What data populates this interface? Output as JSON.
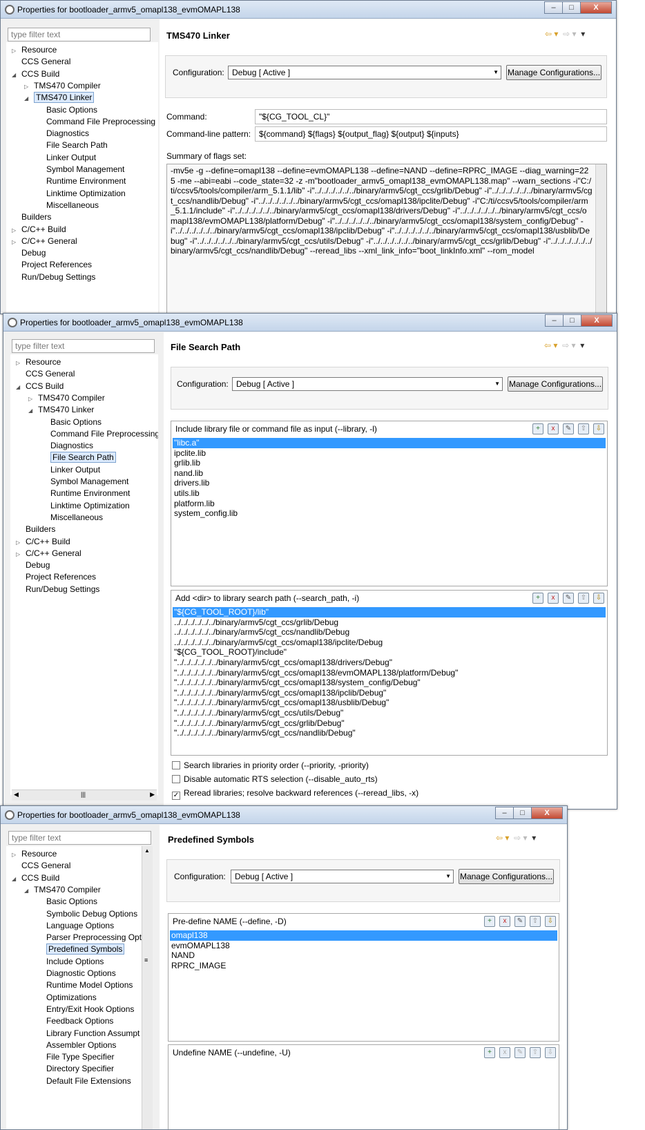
{
  "window_title": "Properties for bootloader_armv5_omapl138_evmOMAPL138",
  "window_buttons": {
    "minimize": "–",
    "maximize": "□",
    "close": "X"
  },
  "filter_placeholder": "type filter text",
  "config": {
    "label": "Configuration:",
    "value": "Debug  [ Active ]",
    "manage": "Manage Configurations..."
  },
  "nav": {
    "back": "⇦ ▾",
    "fwd": "⇨ ▾",
    "menu": "▾"
  },
  "win1": {
    "title": "TMS470 Linker",
    "tree": [
      {
        "label": "Resource",
        "d": 0,
        "arr": "▷"
      },
      {
        "label": "CCS General",
        "d": 0,
        "arr": ""
      },
      {
        "label": "CCS Build",
        "d": 0,
        "arr": "◢"
      },
      {
        "label": "TMS470 Compiler",
        "d": 1,
        "arr": "▷"
      },
      {
        "label": "TMS470 Linker",
        "d": 1,
        "arr": "◢",
        "sel": true
      },
      {
        "label": "Basic Options",
        "d": 2,
        "arr": ""
      },
      {
        "label": "Command File Preprocessing",
        "d": 2,
        "arr": ""
      },
      {
        "label": "Diagnostics",
        "d": 2,
        "arr": ""
      },
      {
        "label": "File Search Path",
        "d": 2,
        "arr": ""
      },
      {
        "label": "Linker Output",
        "d": 2,
        "arr": ""
      },
      {
        "label": "Symbol Management",
        "d": 2,
        "arr": ""
      },
      {
        "label": "Runtime Environment",
        "d": 2,
        "arr": ""
      },
      {
        "label": "Linktime Optimization",
        "d": 2,
        "arr": ""
      },
      {
        "label": "Miscellaneous",
        "d": 2,
        "arr": ""
      },
      {
        "label": "Builders",
        "d": 0,
        "arr": ""
      },
      {
        "label": "C/C++ Build",
        "d": 0,
        "arr": "▷"
      },
      {
        "label": "C/C++ General",
        "d": 0,
        "arr": "▷"
      },
      {
        "label": "Debug",
        "d": 0,
        "arr": ""
      },
      {
        "label": "Project References",
        "d": 0,
        "arr": ""
      },
      {
        "label": "Run/Debug Settings",
        "d": 0,
        "arr": ""
      }
    ],
    "command_label": "Command:",
    "command_value": "\"${CG_TOOL_CL}\"",
    "pattern_label": "Command-line pattern:",
    "pattern_value": "${command} ${flags} ${output_flag} ${output} ${inputs}",
    "summary_label": "Summary of flags set:",
    "summary_text": "-mv5e -g --define=omapl138 --define=evmOMAPL138 --define=NAND --define=RPRC_IMAGE --diag_warning=225 -me --abi=eabi --code_state=32 -z -m\"bootloader_armv5_omapl138_evmOMAPL138.map\" --warn_sections -i\"C:/ti/ccsv5/tools/compiler/arm_5.1.1/lib\" -i\"../../../../../../binary/armv5/cgt_ccs/grlib/Debug\" -i\"../../../../../../binary/armv5/cgt_ccs/nandlib/Debug\" -i\"../../../../../../binary/armv5/cgt_ccs/omapl138/ipclite/Debug\" -i\"C:/ti/ccsv5/tools/compiler/arm_5.1.1/include\" -i\"../../../../../../binary/armv5/cgt_ccs/omapl138/drivers/Debug\" -i\"../../../../../../binary/armv5/cgt_ccs/omapl138/evmOMAPL138/platform/Debug\" -i\"../../../../../../binary/armv5/cgt_ccs/omapl138/system_config/Debug\" -i\"../../../../../../binary/armv5/cgt_ccs/omapl138/ipclib/Debug\" -i\"../../../../../../binary/armv5/cgt_ccs/omapl138/usblib/Debug\" -i\"../../../../../../binary/armv5/cgt_ccs/utils/Debug\" -i\"../../../../../../binary/armv5/cgt_ccs/grlib/Debug\" -i\"../../../../../../binary/armv5/cgt_ccs/nandlib/Debug\" --reread_libs --xml_link_info=\"boot_linkInfo.xml\" --rom_model"
  },
  "win2": {
    "title": "File Search Path",
    "tree": [
      {
        "label": "Resource",
        "d": 0,
        "arr": "▷"
      },
      {
        "label": "CCS General",
        "d": 0,
        "arr": ""
      },
      {
        "label": "CCS Build",
        "d": 0,
        "arr": "◢"
      },
      {
        "label": "TMS470 Compiler",
        "d": 1,
        "arr": "▷"
      },
      {
        "label": "TMS470 Linker",
        "d": 1,
        "arr": "◢"
      },
      {
        "label": "Basic Options",
        "d": 2,
        "arr": ""
      },
      {
        "label": "Command File Preprocessing",
        "d": 2,
        "arr": ""
      },
      {
        "label": "Diagnostics",
        "d": 2,
        "arr": ""
      },
      {
        "label": "File Search Path",
        "d": 2,
        "arr": "",
        "sel": true
      },
      {
        "label": "Linker Output",
        "d": 2,
        "arr": ""
      },
      {
        "label": "Symbol Management",
        "d": 2,
        "arr": ""
      },
      {
        "label": "Runtime Environment",
        "d": 2,
        "arr": ""
      },
      {
        "label": "Linktime Optimization",
        "d": 2,
        "arr": ""
      },
      {
        "label": "Miscellaneous",
        "d": 2,
        "arr": ""
      },
      {
        "label": "Builders",
        "d": 0,
        "arr": ""
      },
      {
        "label": "C/C++ Build",
        "d": 0,
        "arr": "▷"
      },
      {
        "label": "C/C++ General",
        "d": 0,
        "arr": "▷"
      },
      {
        "label": "Debug",
        "d": 0,
        "arr": ""
      },
      {
        "label": "Project References",
        "d": 0,
        "arr": ""
      },
      {
        "label": "Run/Debug Settings",
        "d": 0,
        "arr": ""
      }
    ],
    "lib_header": "Include library file or command file as input (--library, -l)",
    "lib_items": [
      "\"libc.a\"",
      "ipclite.lib",
      "grlib.lib",
      "nand.lib",
      "drivers.lib",
      "utils.lib",
      "platform.lib",
      "system_config.lib"
    ],
    "path_header": "Add <dir> to library search path (--search_path, -i)",
    "path_items": [
      "\"${CG_TOOL_ROOT}/lib\"",
      "../../../../../../binary/armv5/cgt_ccs/grlib/Debug",
      "../../../../../../binary/armv5/cgt_ccs/nandlib/Debug",
      "../../../../../../binary/armv5/cgt_ccs/omapl138/ipclite/Debug",
      "\"${CG_TOOL_ROOT}/include\"",
      "\"../../../../../../binary/armv5/cgt_ccs/omapl138/drivers/Debug\"",
      "\"../../../../../../binary/armv5/cgt_ccs/omapl138/evmOMAPL138/platform/Debug\"",
      "\"../../../../../../binary/armv5/cgt_ccs/omapl138/system_config/Debug\"",
      "\"../../../../../../binary/armv5/cgt_ccs/omapl138/ipclib/Debug\"",
      "\"../../../../../../binary/armv5/cgt_ccs/omapl138/usblib/Debug\"",
      "\"../../../../../../binary/armv5/cgt_ccs/utils/Debug\"",
      "\"../../../../../../binary/armv5/cgt_ccs/grlib/Debug\"",
      "\"../../../../../../binary/armv5/cgt_ccs/nandlib/Debug\""
    ],
    "checks": [
      {
        "label": "Search libraries in priority order (--priority, -priority)",
        "checked": false
      },
      {
        "label": "Disable automatic RTS selection (--disable_auto_rts)",
        "checked": false
      },
      {
        "label": "Reread libraries; resolve backward references (--reread_libs, -x)",
        "checked": true
      }
    ]
  },
  "win3": {
    "title": "Predefined Symbols",
    "tree": [
      {
        "label": "Resource",
        "d": 0,
        "arr": "▷"
      },
      {
        "label": "CCS General",
        "d": 0,
        "arr": ""
      },
      {
        "label": "CCS Build",
        "d": 0,
        "arr": "◢"
      },
      {
        "label": "TMS470 Compiler",
        "d": 1,
        "arr": "◢"
      },
      {
        "label": "Basic Options",
        "d": 2,
        "arr": ""
      },
      {
        "label": "Symbolic Debug Options",
        "d": 2,
        "arr": ""
      },
      {
        "label": "Language Options",
        "d": 2,
        "arr": ""
      },
      {
        "label": "Parser Preprocessing Opti",
        "d": 2,
        "arr": ""
      },
      {
        "label": "Predefined Symbols",
        "d": 2,
        "arr": "",
        "sel": true
      },
      {
        "label": "Include Options",
        "d": 2,
        "arr": ""
      },
      {
        "label": "Diagnostic Options",
        "d": 2,
        "arr": ""
      },
      {
        "label": "Runtime Model Options",
        "d": 2,
        "arr": ""
      },
      {
        "label": "Optimizations",
        "d": 2,
        "arr": ""
      },
      {
        "label": "Entry/Exit Hook Options",
        "d": 2,
        "arr": ""
      },
      {
        "label": "Feedback Options",
        "d": 2,
        "arr": ""
      },
      {
        "label": "Library Function Assumpt",
        "d": 2,
        "arr": ""
      },
      {
        "label": "Assembler Options",
        "d": 2,
        "arr": ""
      },
      {
        "label": "File Type Specifier",
        "d": 2,
        "arr": ""
      },
      {
        "label": "Directory Specifier",
        "d": 2,
        "arr": ""
      },
      {
        "label": "Default File Extensions",
        "d": 2,
        "arr": ""
      }
    ],
    "define_header": "Pre-define NAME (--define, -D)",
    "define_items": [
      "omapl138",
      "evmOMAPL138",
      "NAND",
      "RPRC_IMAGE"
    ],
    "undefine_header": "Undefine NAME (--undefine, -U)"
  }
}
